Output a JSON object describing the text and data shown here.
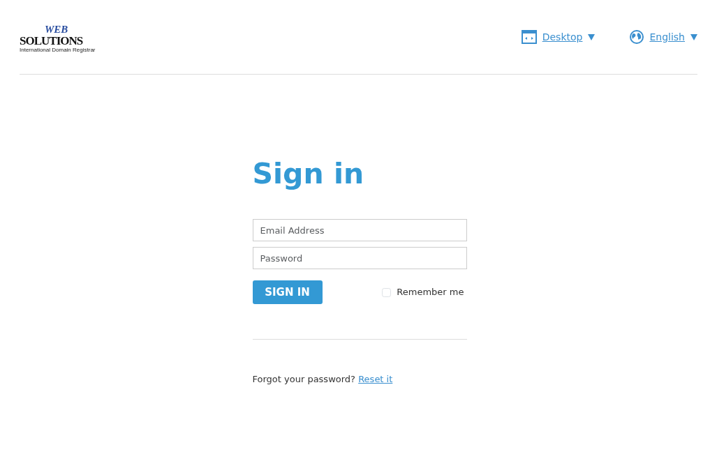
{
  "logo": {
    "top": "WEB",
    "main": "SOLUTIONS",
    "tagline": "International Domain Registrar"
  },
  "header_menus": [
    {
      "kind": "view",
      "label": "Desktop"
    },
    {
      "kind": "language",
      "label": "English"
    }
  ],
  "form": {
    "title": "Sign in",
    "fields": [
      {
        "placeholder": "Email Address"
      },
      {
        "placeholder": "Password"
      }
    ],
    "submit": "SIGN IN",
    "remember": {
      "label": "Remember me",
      "checked": false
    },
    "forgot": {
      "text": "Forgot your password?",
      "link": "Reset it"
    }
  }
}
